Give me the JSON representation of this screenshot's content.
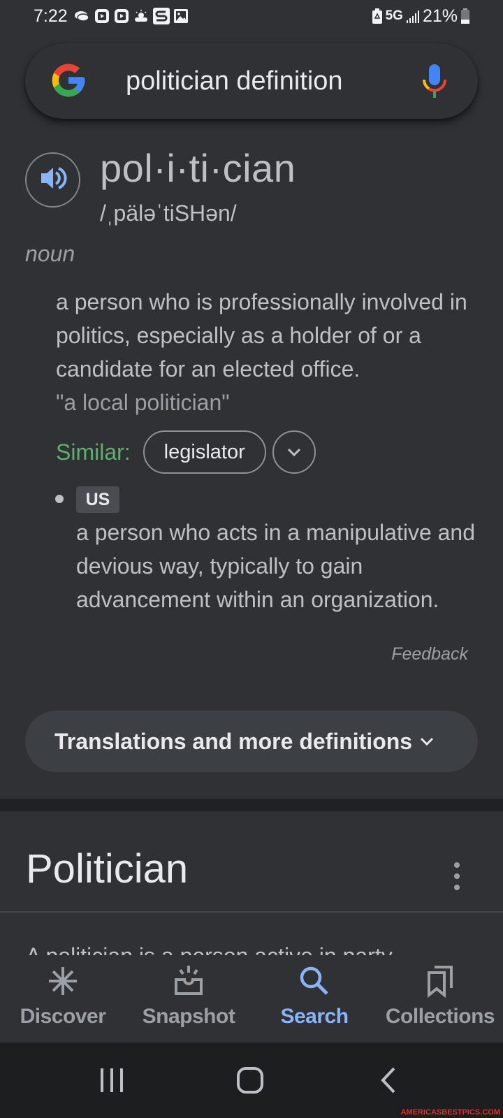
{
  "status_bar": {
    "time": "7:22",
    "left_icons": [
      "cloud-notification-icon",
      "video-play-icon",
      "video-play-icon",
      "weather-partly-sunny-icon",
      "s-app-icon",
      "gallery-image-icon"
    ],
    "network": "5G",
    "battery_percent": "21%"
  },
  "search": {
    "query": "politician definition",
    "colors": {
      "blue": "#4285f4",
      "red": "#ea4335",
      "yellow": "#fbbc05",
      "green": "#34a853"
    }
  },
  "dictionary": {
    "headword": "pol·i·ti·cian",
    "phonetic": "/ˌpäləˈtiSHən/",
    "part_of_speech": "noun",
    "definitions": [
      {
        "text": "a person who is professionally involved in politics, especially as a holder of or a candidate for an elected office.",
        "example": "\"a local politician\"",
        "similar_label": "Similar:",
        "similar": [
          "legislator"
        ]
      },
      {
        "label": "US",
        "text": "a person who acts in a manipulative and devious way, typically to gain advancement within an organization."
      }
    ],
    "feedback": "Feedback",
    "more_button": "Translations and more definitions",
    "accent_green": "#5fb06d",
    "accent_blue": "#8ab4f8"
  },
  "wiki": {
    "title": "Politician",
    "snippet": "A politician is a person active in party"
  },
  "bottom_nav": {
    "items": [
      {
        "label": "Discover",
        "icon": "asterisk-icon",
        "active": false
      },
      {
        "label": "Snapshot",
        "icon": "snapshot-tray-icon",
        "active": false
      },
      {
        "label": "Search",
        "icon": "search-icon",
        "active": true
      },
      {
        "label": "Collections",
        "icon": "bookmarks-icon",
        "active": false
      }
    ]
  },
  "watermark": "AMERICASBESTPICS.COM"
}
